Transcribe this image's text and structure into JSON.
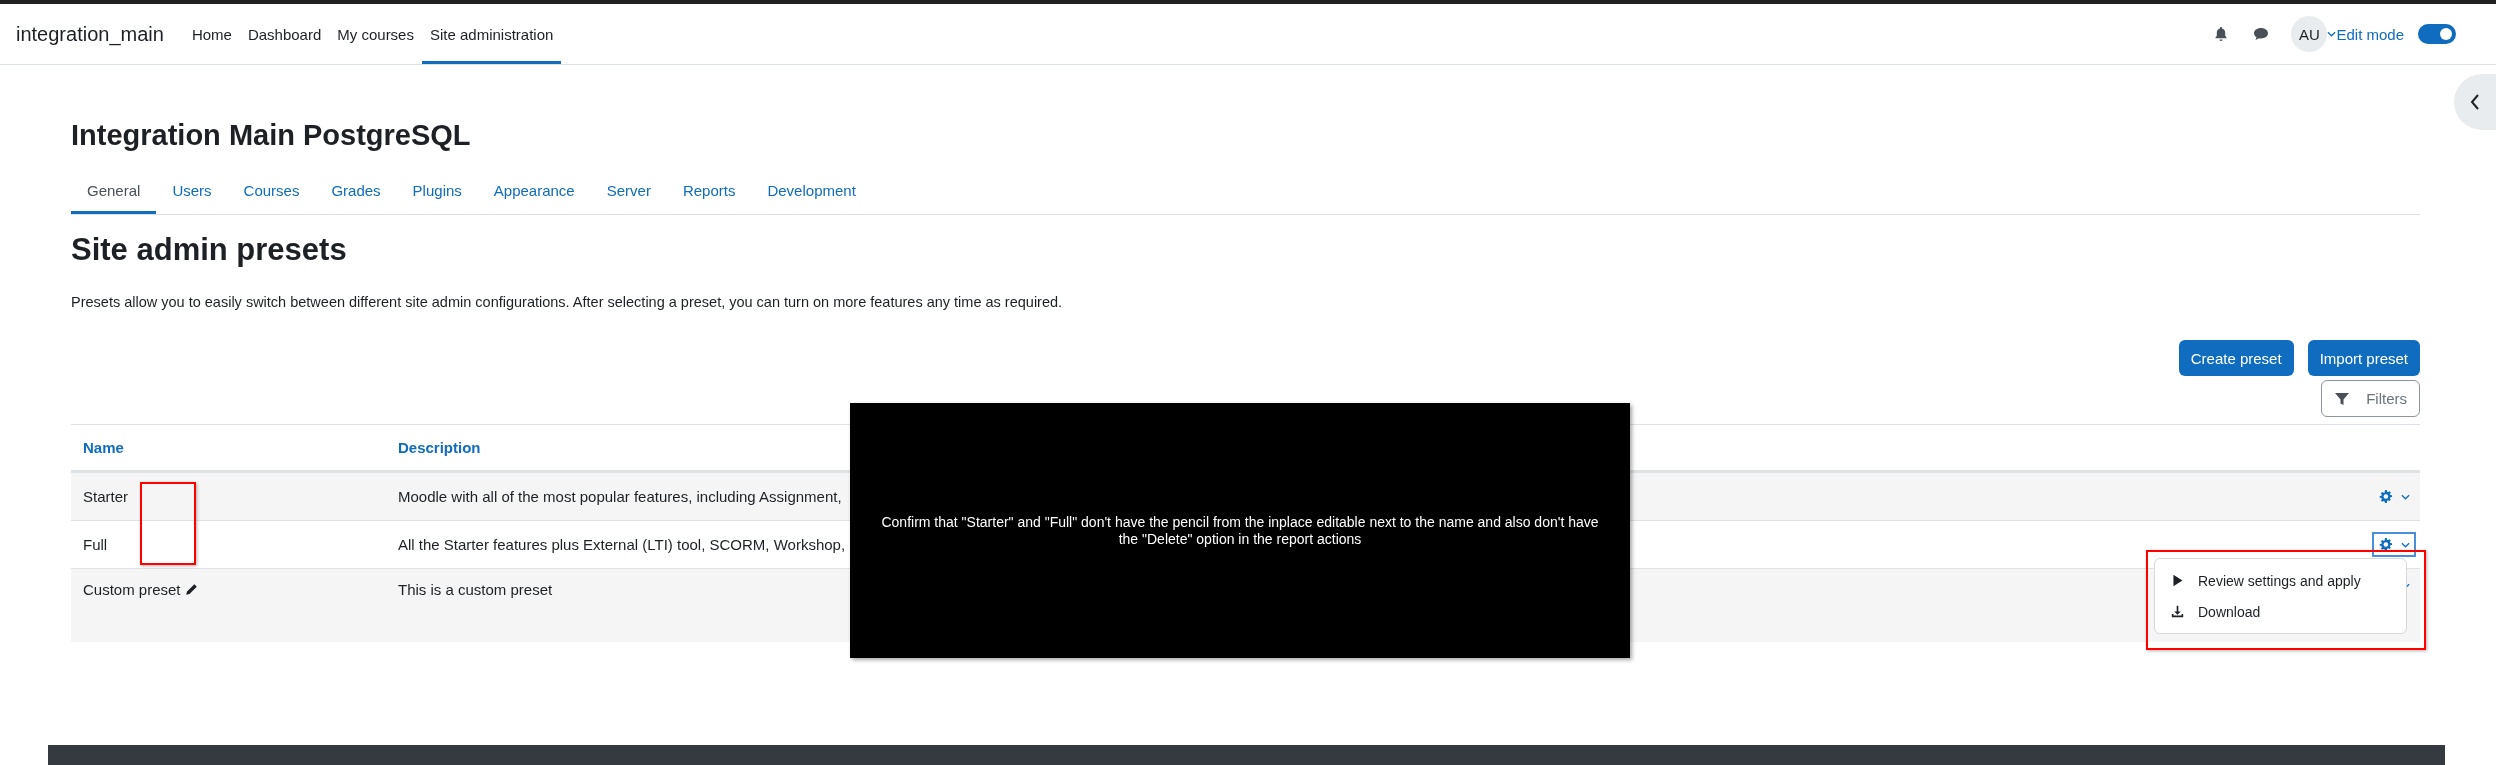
{
  "navbar": {
    "brand": "integration_main",
    "items": [
      {
        "label": "Home",
        "selected": false
      },
      {
        "label": "Dashboard",
        "selected": false
      },
      {
        "label": "My courses",
        "selected": false
      },
      {
        "label": "Site administration",
        "selected": true
      }
    ],
    "avatar": "AU",
    "edit_mode": {
      "label": "Edit mode",
      "on": true
    }
  },
  "page_title": "Integration Main PostgreSQL",
  "tabs": [
    {
      "label": "General",
      "selected": true
    },
    {
      "label": "Users",
      "selected": false
    },
    {
      "label": "Courses",
      "selected": false
    },
    {
      "label": "Grades",
      "selected": false
    },
    {
      "label": "Plugins",
      "selected": false
    },
    {
      "label": "Appearance",
      "selected": false
    },
    {
      "label": "Server",
      "selected": false
    },
    {
      "label": "Reports",
      "selected": false
    },
    {
      "label": "Development",
      "selected": false
    }
  ],
  "heading": "Site admin presets",
  "intro": "Presets allow you to easily switch between different site admin configurations. After selecting a preset, you can turn on more features any time as required.",
  "buttons": [
    "Create preset",
    "Import preset"
  ],
  "filters_button": "Filters",
  "table": {
    "columns": [
      "Name",
      "Description"
    ],
    "rows": [
      {
        "name": "Starter",
        "description": "Moodle with all of the most popular features, including Assignment,",
        "editable": false,
        "menu_open": false
      },
      {
        "name": "Full",
        "description": "All the Starter features plus External (LTI) tool, SCORM, Workshop,",
        "editable": false,
        "menu_open": true
      },
      {
        "name": "Custom preset",
        "description": "This is a custom preset",
        "editable": true,
        "menu_open": false
      }
    ]
  },
  "action_menu": {
    "items": [
      {
        "kind": "play",
        "label": "Review settings and apply"
      },
      {
        "kind": "download",
        "label": "Download"
      }
    ]
  },
  "annotation": {
    "text": "Confirm that \"Starter\" and \"Full\" don't have the pencil from the inplace editable next to the name and also don't have the \"Delete\" option in the report actions"
  }
}
